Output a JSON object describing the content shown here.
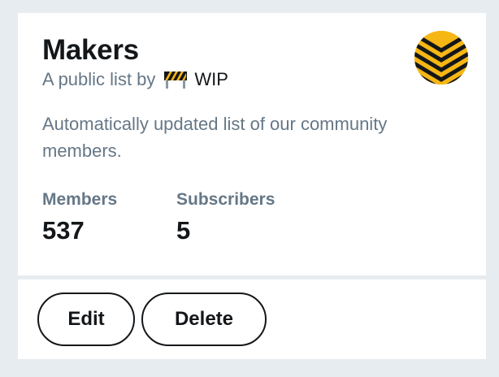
{
  "list": {
    "name": "Makers",
    "byline_prefix": "A public list by",
    "owner_name": "WIP",
    "owner_icon": "construction-barrier-icon",
    "avatar_icon": "chevron-stripes-avatar-icon",
    "description": "Automatically updated list of our community members."
  },
  "stats": {
    "members_label": "Members",
    "members_value": "537",
    "subscribers_label": "Subscribers",
    "subscribers_value": "5"
  },
  "actions": {
    "edit_label": "Edit",
    "delete_label": "Delete"
  },
  "colors": {
    "background": "#e6ecf0",
    "card": "#ffffff",
    "primary_text": "#14171a",
    "secondary_text": "#657786",
    "avatar_yellow": "#f6b614",
    "avatar_black": "#14171a"
  }
}
